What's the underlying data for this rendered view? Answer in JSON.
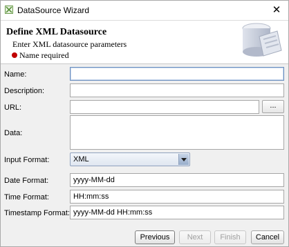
{
  "window": {
    "title": "DataSource Wizard",
    "close_glyph": "✕",
    "app_icon": "datasource-wizard-icon"
  },
  "header": {
    "title": "Define XML Datasource",
    "subtitle": "Enter XML datasource parameters",
    "required_note": "Name required",
    "required_color": "#c00000"
  },
  "form": {
    "name": {
      "label": "Name:",
      "value": ""
    },
    "description": {
      "label": "Description:",
      "value": ""
    },
    "url": {
      "label": "URL:",
      "value": "",
      "browse_label": "..."
    },
    "data": {
      "label": "Data:",
      "value": ""
    },
    "input_format": {
      "label": "Input Format:",
      "value": "XML"
    },
    "date_format": {
      "label": "Date Format:",
      "value": "yyyy-MM-dd"
    },
    "time_format": {
      "label": "Time Format:",
      "value": "HH:mm:ss"
    },
    "timestamp_format": {
      "label": "Timestamp Format:",
      "value": "yyyy-MM-dd HH:mm:ss"
    }
  },
  "buttons": {
    "previous": "Previous",
    "next": "Next",
    "finish": "Finish",
    "cancel": "Cancel"
  }
}
